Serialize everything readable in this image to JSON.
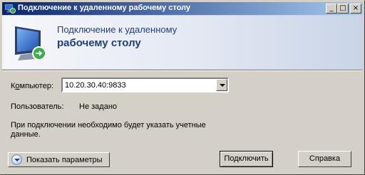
{
  "window": {
    "title": "Подключение к удаленному рабочему столу",
    "controls": {
      "minimize": "_",
      "maximize": "□",
      "close": "×"
    }
  },
  "banner": {
    "line1": "Подключение к удаленному",
    "line2": "рабочему столу",
    "icon": "remote-desktop-icon"
  },
  "form": {
    "computer_label_prefix": "К",
    "computer_label_underlined": "о",
    "computer_label_suffix": "мпьютер:",
    "computer_value": "10.20.30.40:9833",
    "user_label": "Пользователь:",
    "user_value": "Не задано",
    "note": "При подключении необходимо будет указать учетные данные."
  },
  "buttons": {
    "options": "Показать параметры",
    "connect": "Подключить",
    "help": "Справка"
  }
}
